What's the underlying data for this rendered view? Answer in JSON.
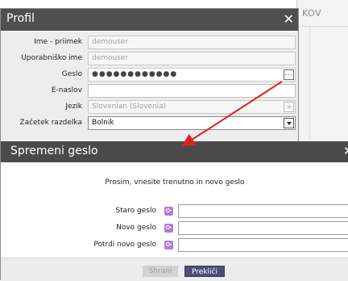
{
  "background_window": {
    "partial_title": "KOV"
  },
  "profile_dialog": {
    "title": "Profil",
    "close_symbol": "✕",
    "fields": [
      {
        "label": "Ime - priimek",
        "value": "demouser"
      },
      {
        "label": "Uporabniško ime",
        "value": "demouser"
      },
      {
        "label": "Geslo",
        "value": "●●●●●●●●●●●●",
        "button": "..."
      },
      {
        "label": "E-naslov",
        "value": ""
      },
      {
        "label": "Jezik",
        "value": "Slovenian (Slovenia)"
      },
      {
        "label": "Začetek razdelka",
        "value": "Bolnik"
      }
    ]
  },
  "change_password_dialog": {
    "title": "Spremeni geslo",
    "close_symbol": "✕",
    "prompt": "Prosim, vnesite trenutno in novo geslo",
    "fields": [
      {
        "label": "Staro geslo",
        "value": ""
      },
      {
        "label": "Novo geslo",
        "value": ""
      },
      {
        "label": "Potrdi novo geslo",
        "value": ""
      }
    ],
    "buttons": {
      "save": "Shrani",
      "cancel": "Prekliči"
    }
  },
  "colors": {
    "annotation_arrow": "#e02020",
    "key_icon": "#b57bd8",
    "cancel_button": "#4d4d7a",
    "titlebar": "#4f4f4f"
  },
  "icons": {
    "key": "key-icon",
    "close": "close-icon",
    "dropdown": "chevron-down-icon"
  }
}
